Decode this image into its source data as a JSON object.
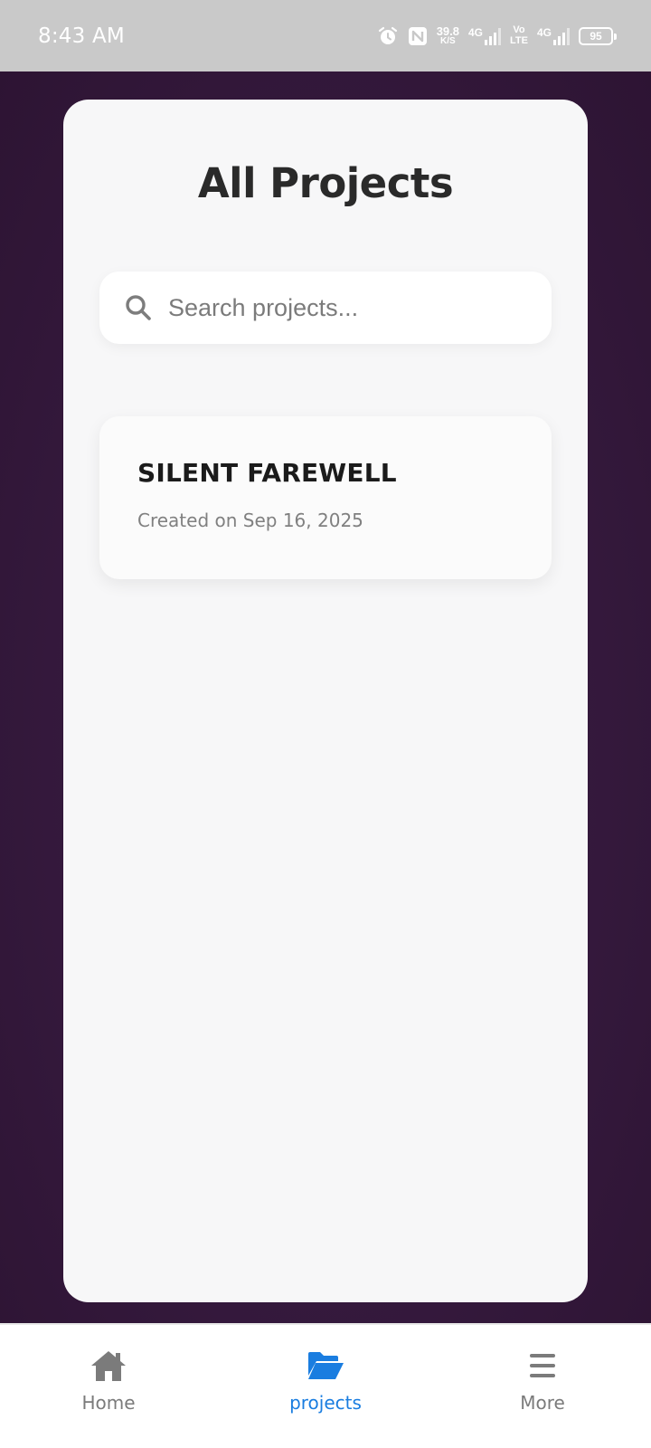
{
  "status_bar": {
    "time": "8:43 AM",
    "net_speed_value": "39.8",
    "net_speed_unit": "K/S",
    "signal1_label": "4G",
    "volte_top": "Vo",
    "volte_bottom": "LTE",
    "signal2_label": "4G",
    "battery": "95"
  },
  "page": {
    "title": "All Projects",
    "search_placeholder": "Search projects...",
    "search_value": ""
  },
  "projects": [
    {
      "name": "SILENT FAREWELL",
      "created": "Created on Sep 16, 2025"
    }
  ],
  "bottom_nav": {
    "items": [
      {
        "label": "Home",
        "icon": "home-icon"
      },
      {
        "label": "projects",
        "icon": "folder-open-icon",
        "active": true
      },
      {
        "label": "More",
        "icon": "menu-icon"
      }
    ]
  },
  "colors": {
    "background": "#35193d",
    "panel": "#f7f7f8",
    "accent": "#1a7de0",
    "muted": "#7b7b7b"
  }
}
